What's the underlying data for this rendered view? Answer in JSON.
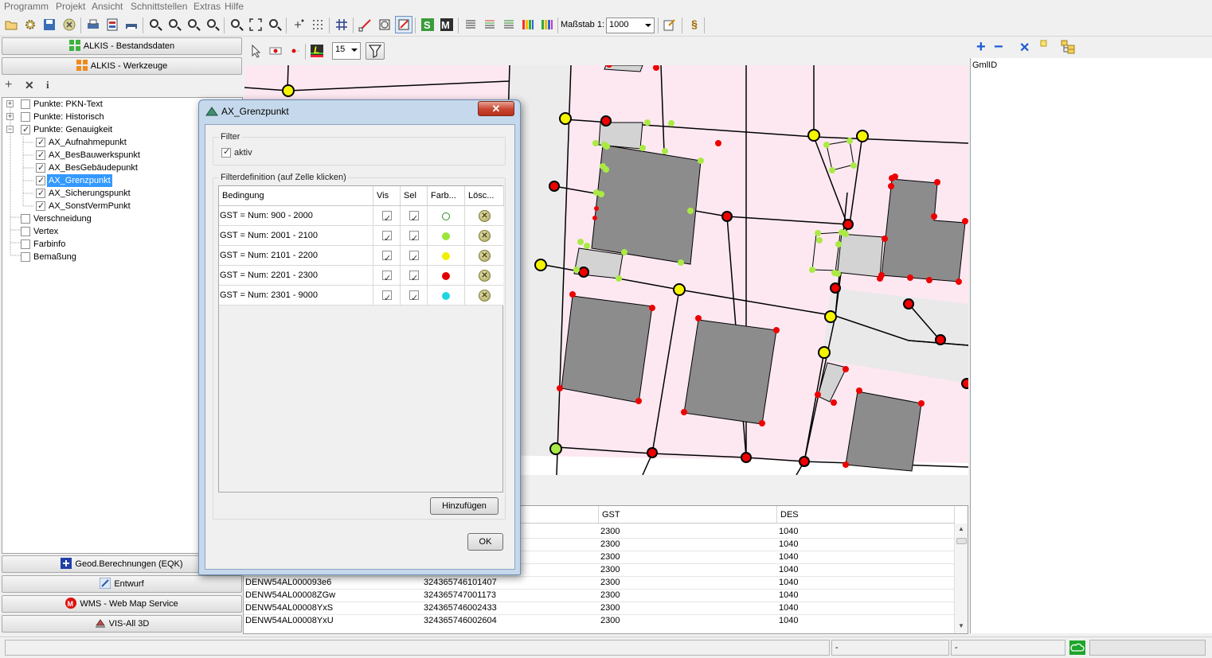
{
  "menu": [
    "Programm",
    "Projekt",
    "Ansicht",
    "Schnittstellen",
    "Extras",
    "Hilfe"
  ],
  "toolbar": {
    "scale_label": "Maßstab 1:",
    "scale_value": "1000",
    "paragraph": "§"
  },
  "left_panel": {
    "top_buttons": [
      "ALKIS - Bestandsdaten",
      "ALKIS - Werkzeuge"
    ],
    "tree": [
      {
        "label": "Punkte: PKN-Text",
        "checked": false,
        "expander": "+"
      },
      {
        "label": "Punkte: Historisch",
        "checked": false,
        "expander": "+"
      },
      {
        "label": "Punkte: Genauigkeit",
        "checked": true,
        "expander": "−"
      },
      {
        "label": "AX_Aufnahmepunkt",
        "checked": true
      },
      {
        "label": "AX_BesBauwerkspunkt",
        "checked": true
      },
      {
        "label": "AX_BesGebäudepunkt",
        "checked": true
      },
      {
        "label": "AX_Grenzpunkt",
        "checked": true,
        "selected": true
      },
      {
        "label": "AX_Sicherungspunkt",
        "checked": true
      },
      {
        "label": "AX_SonstVermPunkt",
        "checked": true
      },
      {
        "label": "Verschneidung",
        "checked": false
      },
      {
        "label": "Vertex",
        "checked": false
      },
      {
        "label": "Farbinfo",
        "checked": false
      },
      {
        "label": "Bemaßung",
        "checked": false
      }
    ],
    "bottom_buttons": [
      "Geod.Berechnungen (EQK)",
      "Entwurf",
      "WMS - Web Map Service",
      "VIS-All 3D"
    ]
  },
  "map_toolbar": {
    "size_value": "15"
  },
  "right_panel": {
    "header": "GmlID"
  },
  "table": {
    "columns": [
      "",
      "",
      "GST",
      "DES"
    ],
    "rows": [
      [
        "",
        "",
        "2300",
        "1040"
      ],
      [
        "",
        "",
        "2300",
        "1040"
      ],
      [
        "",
        "",
        "2300",
        "1040"
      ],
      [
        "",
        "",
        "2300",
        "1040"
      ],
      [
        "DENW54AL000093e6",
        "324365746101407",
        "2300",
        "1040"
      ],
      [
        "DENW54AL00008ZGw",
        "324365747001173",
        "2300",
        "1040"
      ],
      [
        "DENW54AL00008YxS",
        "324365746002433",
        "2300",
        "1040"
      ],
      [
        "DENW54AL00008YxU",
        "324365746002604",
        "2300",
        "1040"
      ]
    ]
  },
  "status": {
    "field1": "-",
    "field2": "-"
  },
  "dialog": {
    "title": "AX_Grenzpunkt",
    "filter_group": "Filter",
    "filter_active": "aktiv",
    "definition_group": "Filterdefinition (auf Zelle klicken)",
    "columns": [
      "Bedingung",
      "Vis",
      "Sel",
      "Farb...",
      "Lösc..."
    ],
    "rows": [
      {
        "condition": "GST = Num: 900 - 2000",
        "color": "#ffffff",
        "ring": "#2e8b2e"
      },
      {
        "condition": "GST = Num: 2001 - 2100",
        "color": "#9be63a"
      },
      {
        "condition": "GST = Num: 2101 - 2200",
        "color": "#f0f000"
      },
      {
        "condition": "GST = Num: 2201 - 2300",
        "color": "#e00000"
      },
      {
        "condition": "GST = Num: 2301 - 9000",
        "color": "#1fd6e0"
      }
    ],
    "add_button": "Hinzufügen",
    "ok_button": "OK"
  },
  "colors": {
    "map_bg": "#fde8f2",
    "building": "#8c8c8c",
    "accent_selected": "#3399ff"
  }
}
